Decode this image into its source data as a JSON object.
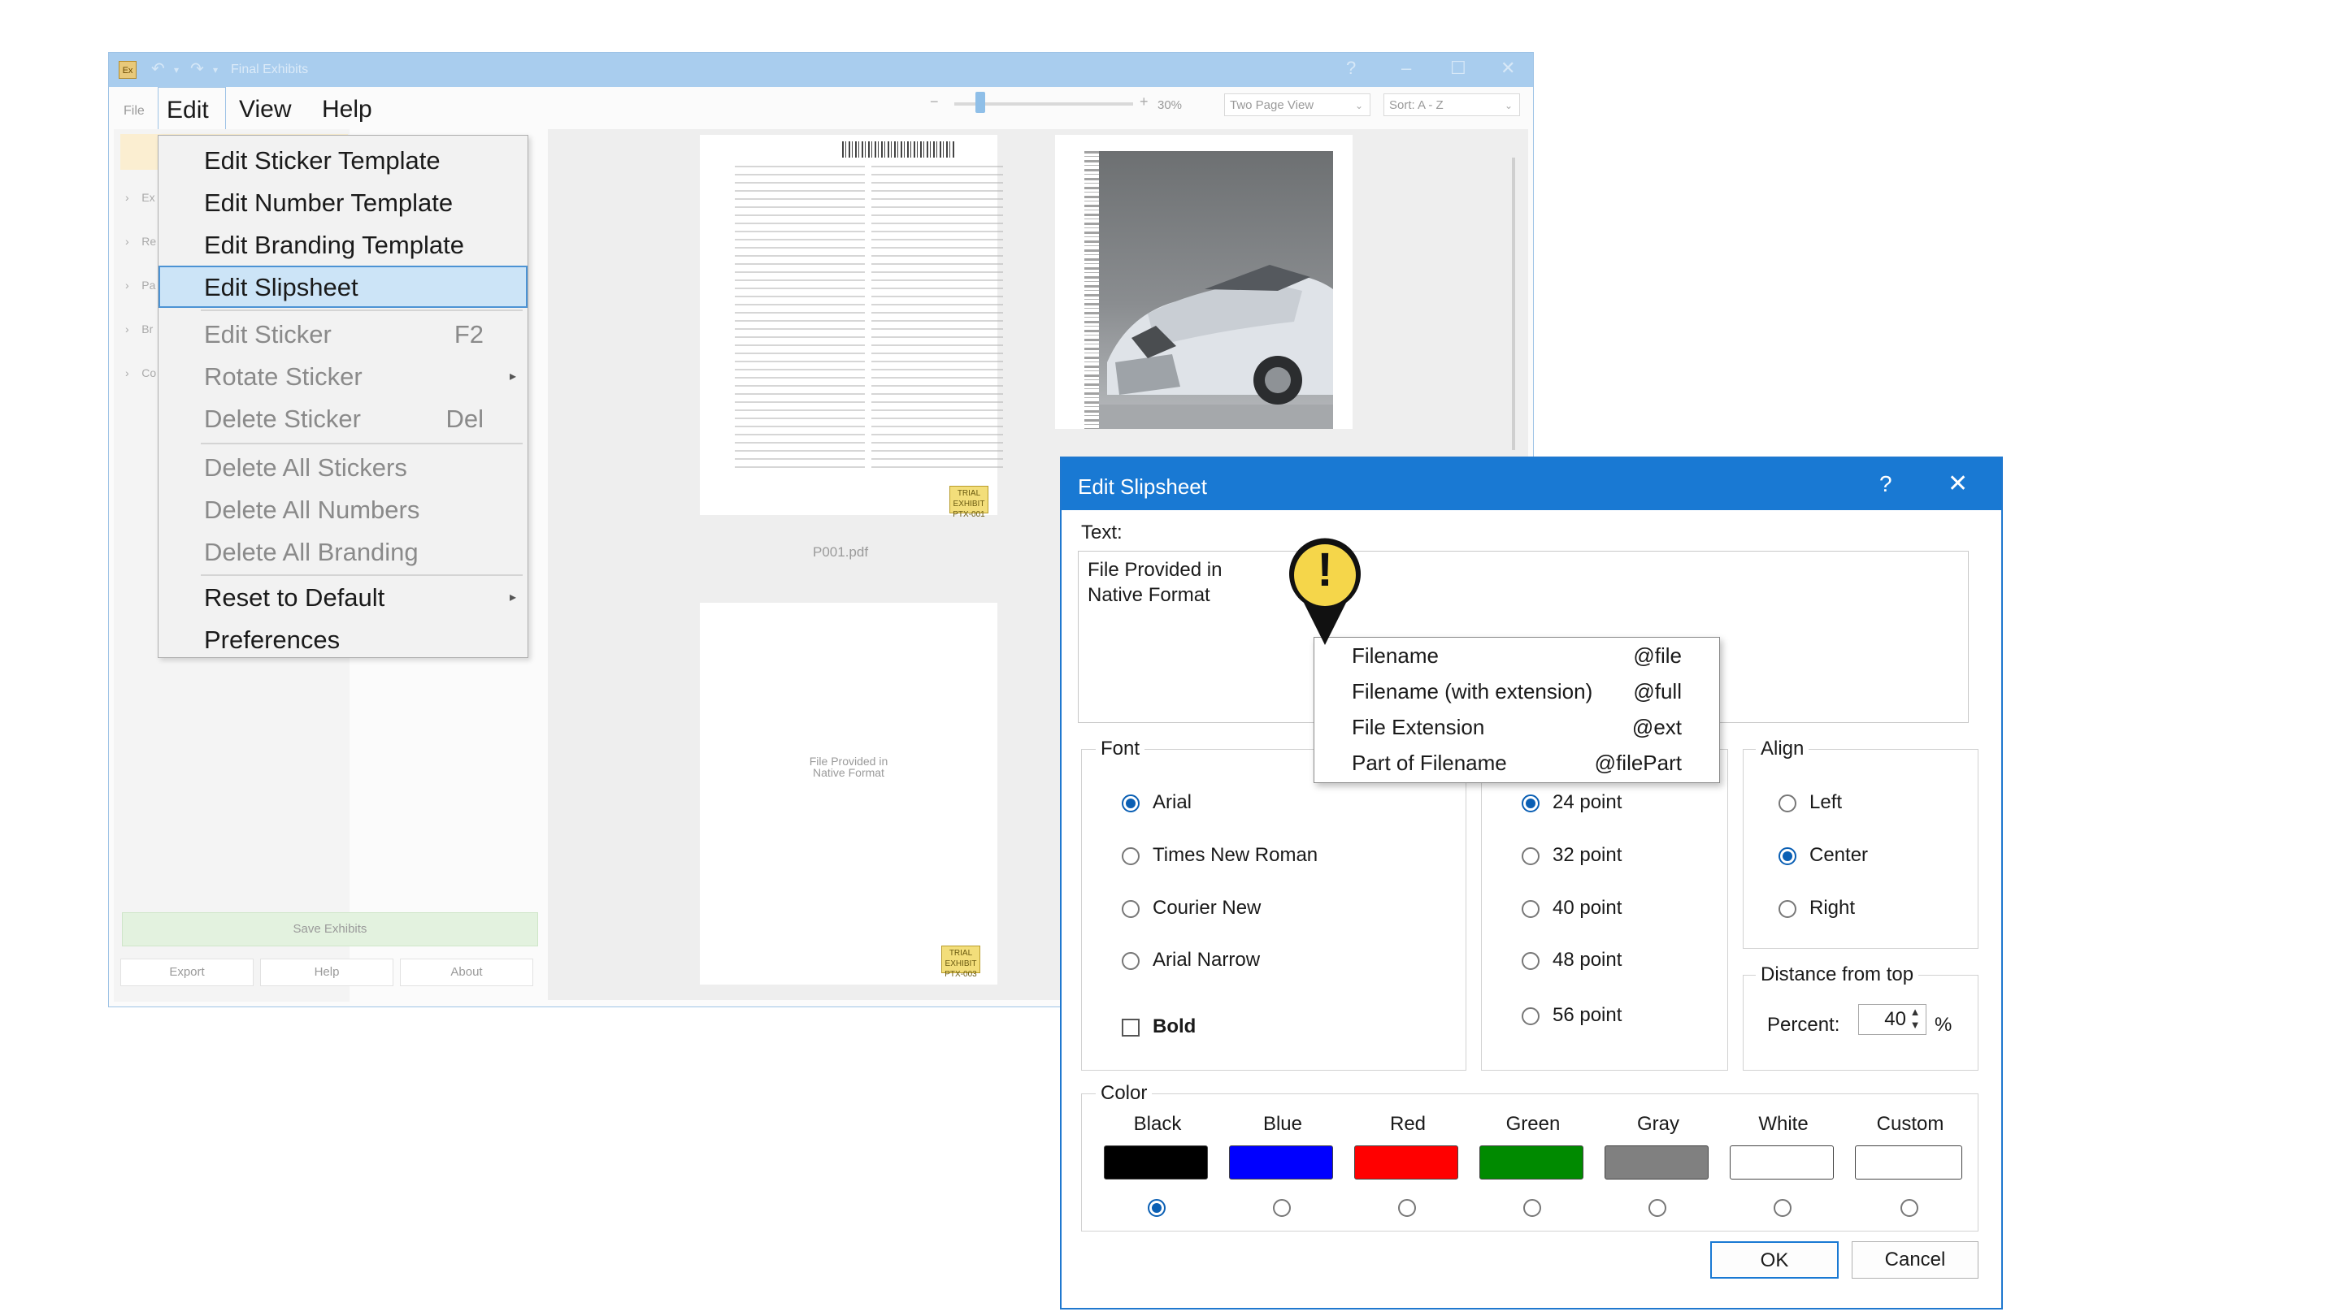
{
  "app": {
    "title": "Final Exhibits",
    "icon_text": "Ex",
    "menu": {
      "file": "File",
      "edit": "Edit",
      "view": "View",
      "help": "Help"
    },
    "toolbar": {
      "zoom_level": "30%",
      "view_mode": "Two Page View",
      "sort": "Sort: A - Z"
    },
    "left_panel": {
      "tree_rows": [
        "Ex",
        "Re",
        "Pa",
        "Br",
        "Co"
      ],
      "save_button": "Save Exhibits",
      "export_button": "Export",
      "help_button": "Help",
      "about_button": "About"
    },
    "documents": {
      "page1_caption": "P001.pdf",
      "page1_sticker": "TRIAL EXHIBIT\nPTX-001",
      "page2_text": "File Provided in\nNative Format",
      "page2_sticker": "TRIAL EXHIBIT\nPTX-003"
    }
  },
  "edit_menu": {
    "items": [
      {
        "label": "Edit Sticker Template"
      },
      {
        "label": "Edit Number Template"
      },
      {
        "label": "Edit Branding Template"
      },
      {
        "label": "Edit Slipsheet"
      },
      {
        "label": "Edit Sticker",
        "shortcut": "F2"
      },
      {
        "label": "Rotate Sticker"
      },
      {
        "label": "Delete Sticker",
        "shortcut": "Del"
      },
      {
        "label": "Delete All Stickers"
      },
      {
        "label": "Delete All Numbers"
      },
      {
        "label": "Delete All Branding"
      },
      {
        "label": "Reset to Default"
      },
      {
        "label": "Preferences"
      }
    ]
  },
  "dialog": {
    "title": "Edit Slipsheet",
    "help_glyph": "?",
    "close_glyph": "✕",
    "text_label": "Text:",
    "text_value": "File Provided in\n Native Format",
    "font": {
      "label": "Font",
      "options": [
        "Arial",
        "Times New Roman",
        "Courier New",
        "Arial Narrow"
      ],
      "selected": "Arial",
      "bold_label": "Bold",
      "bold_checked": false
    },
    "size": {
      "options": [
        "24 point",
        "32 point",
        "40 point",
        "48 point",
        "56 point"
      ],
      "selected": "24 point"
    },
    "align": {
      "label": "Align",
      "options": [
        "Left",
        "Center",
        "Right"
      ],
      "selected": "Center"
    },
    "distance": {
      "label": "Distance from top",
      "percent_label": "Percent:",
      "percent_value": "40",
      "unit": "%"
    },
    "color": {
      "label": "Color",
      "options": [
        {
          "name": "Black",
          "hex": "#000000"
        },
        {
          "name": "Blue",
          "hex": "#0000ff"
        },
        {
          "name": "Red",
          "hex": "#ff0000"
        },
        {
          "name": "Green",
          "hex": "#008a00"
        },
        {
          "name": "Gray",
          "hex": "#808080"
        },
        {
          "name": "White",
          "hex": "#ffffff"
        },
        {
          "name": "Custom",
          "hex": "#ffffff"
        }
      ],
      "selected": "Black"
    },
    "ok": "OK",
    "cancel": "Cancel"
  },
  "popup": {
    "rows": [
      {
        "label": "Filename",
        "token": "@file"
      },
      {
        "label": "Filename (with extension)",
        "token": "@full"
      },
      {
        "label": "File Extension",
        "token": "@ext"
      },
      {
        "label": "Part of Filename",
        "token": "@filePart"
      }
    ],
    "alert_glyph": "!"
  }
}
